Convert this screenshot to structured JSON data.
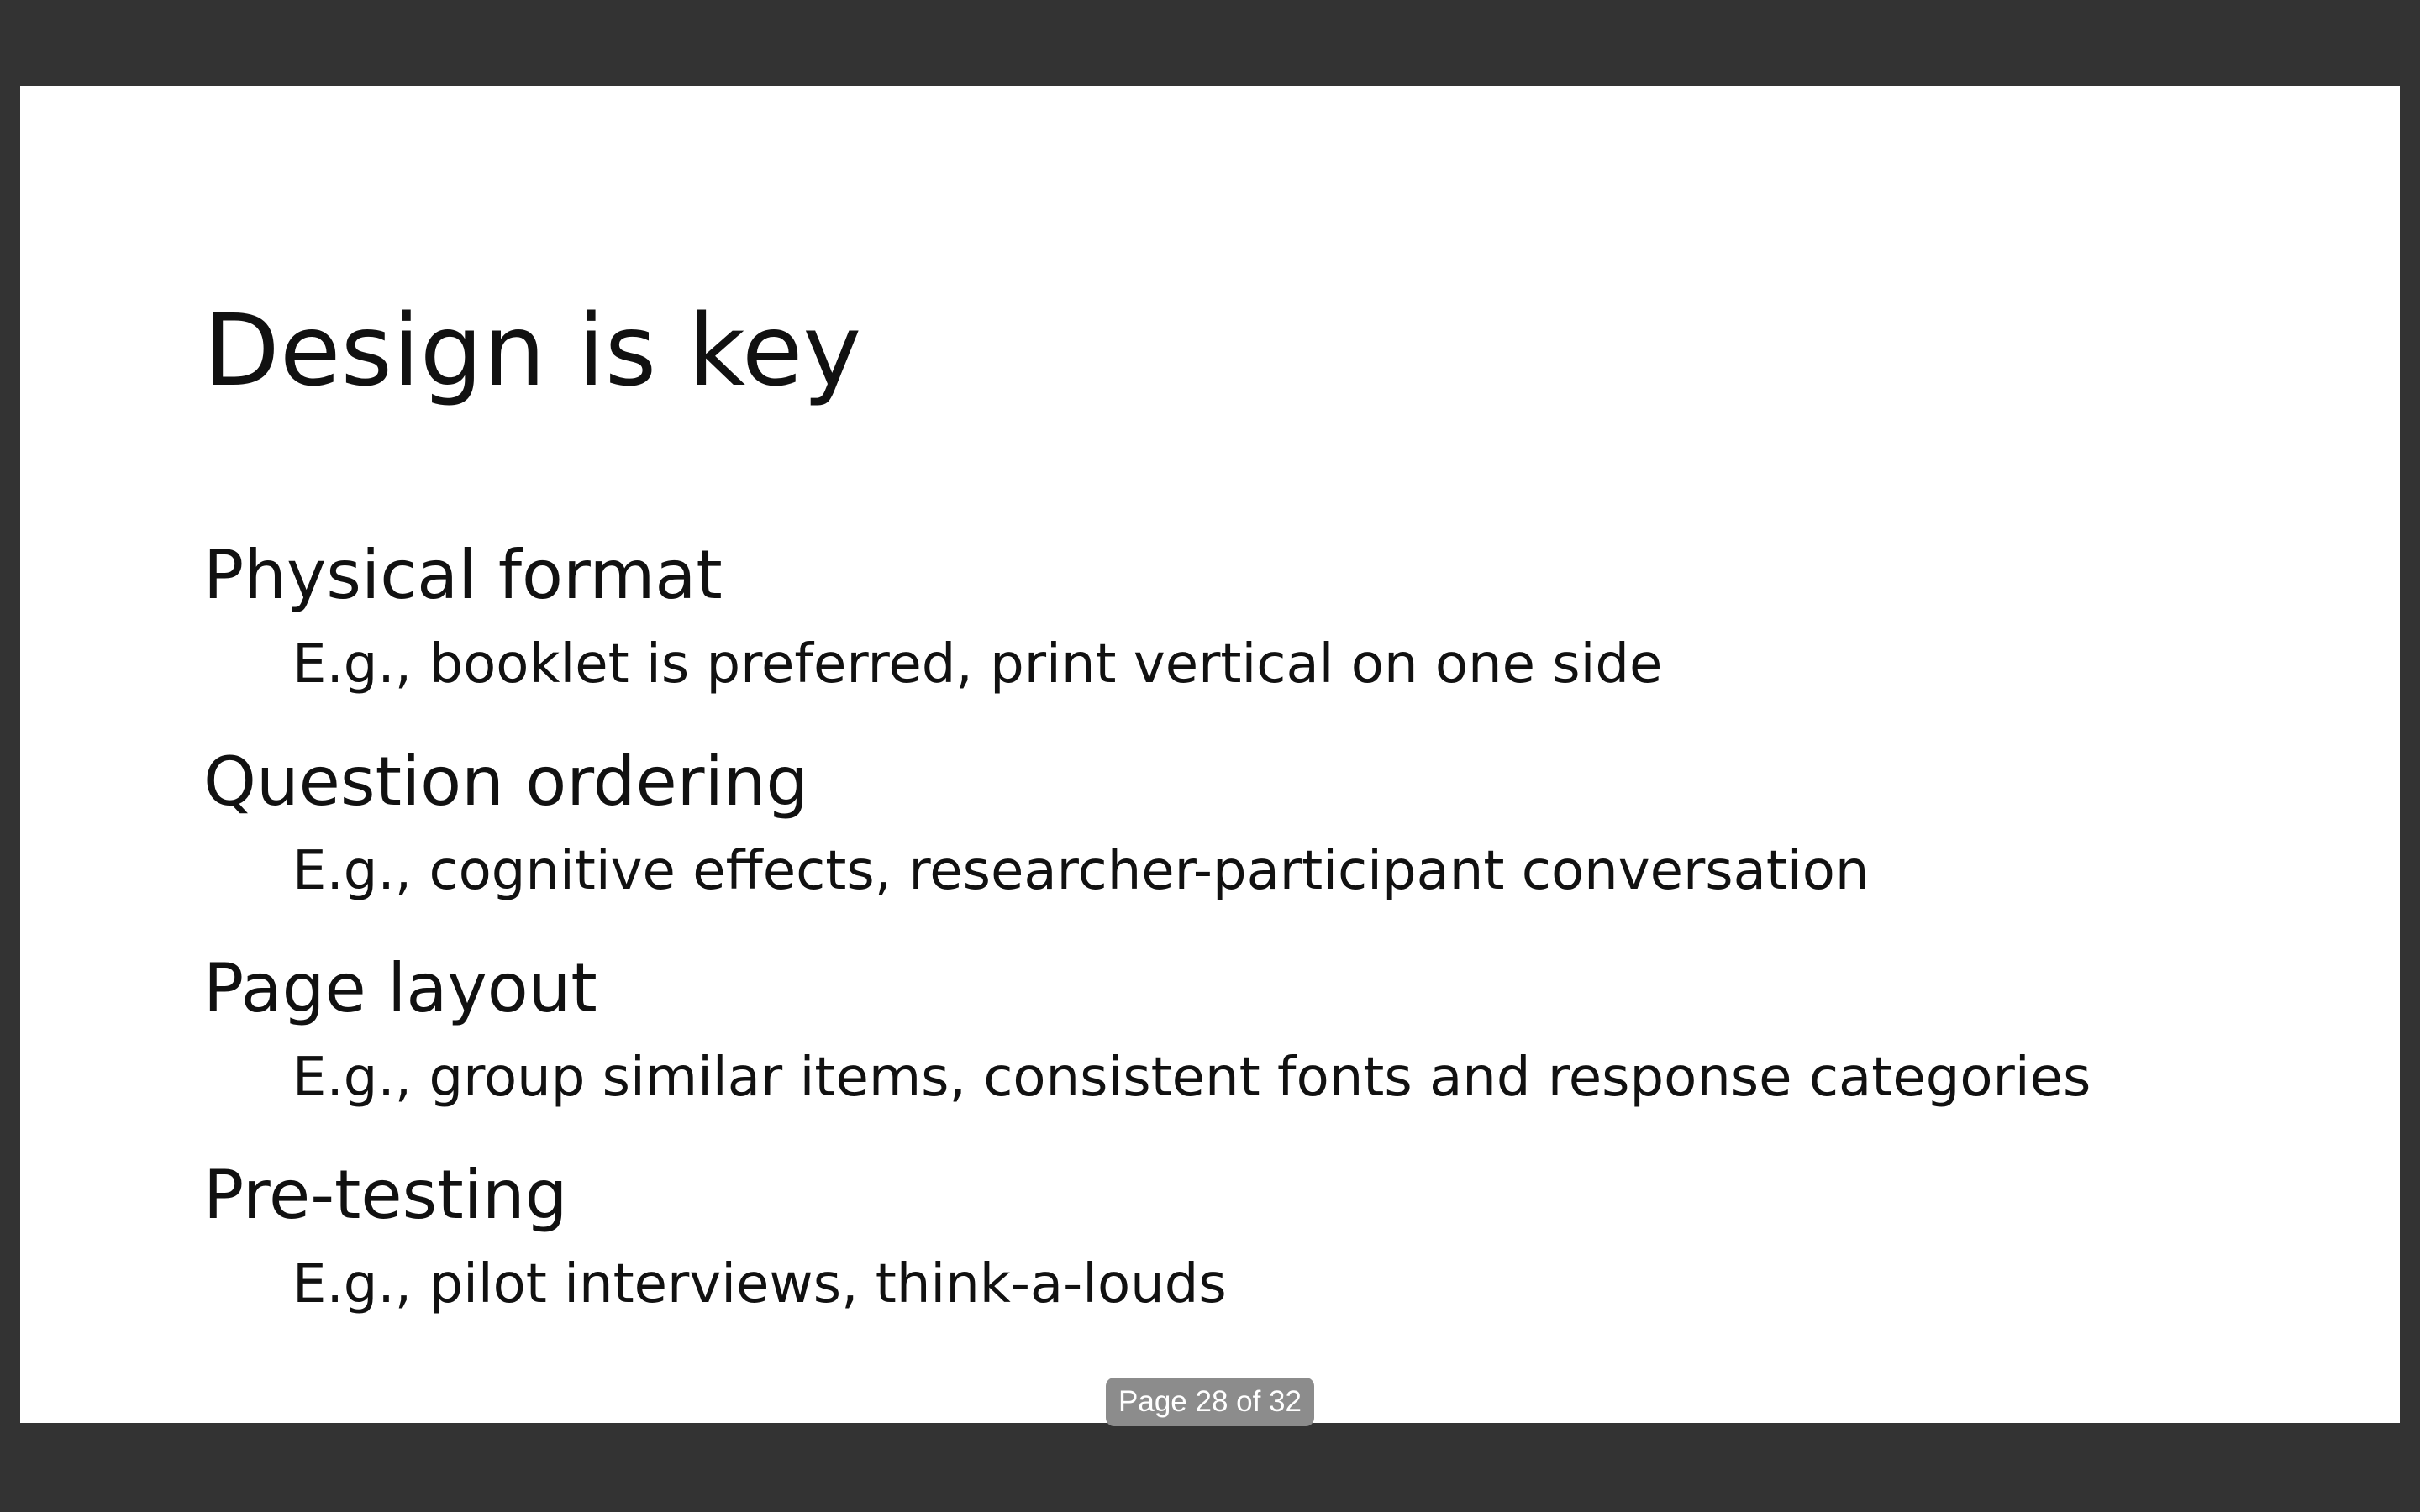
{
  "slide": {
    "title": "Design is key",
    "bullets": [
      {
        "heading": "Physical format",
        "sub": "E.g., booklet is preferred, print vertical on one side"
      },
      {
        "heading": "Question ordering",
        "sub": "E.g., cognitive effects, researcher-participant conversation"
      },
      {
        "heading": "Page layout",
        "sub": "E.g., group similar items, consistent fonts and response categories"
      },
      {
        "heading": "Pre-testing",
        "sub": "E.g., pilot interviews, think-a-louds"
      }
    ]
  },
  "viewer": {
    "page_indicator": "Page 28 of 32",
    "background_color": "#333333",
    "page_color": "#ffffff"
  }
}
